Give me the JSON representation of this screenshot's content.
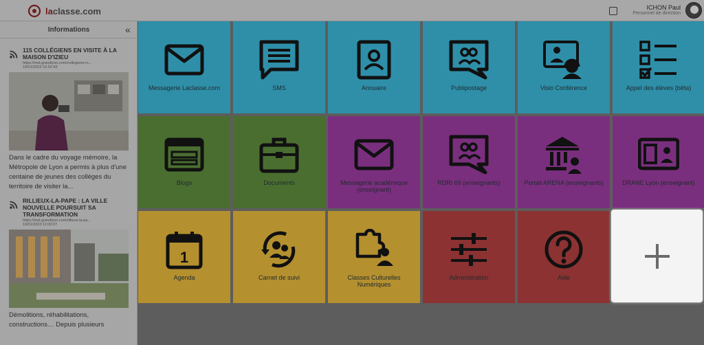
{
  "header": {
    "logo_brand": "la",
    "logo_rest": "classe.com",
    "user_name": "ICHON Paul",
    "user_role": "Personnel de direction"
  },
  "sidebar": {
    "title": "Informations",
    "news": [
      {
        "title": "115 COLLÉGIENS EN VISITE À LA MAISON D'IZIEU",
        "url": "https://met.grandlyon.com/collegiens-m...",
        "date": "19/01/2023 10:52:43",
        "excerpt": "Dans le cadre du voyage mémoire, la Métropole de Lyon a permis à plus d'une centaine de jeunes des collèges du territoire de visiter la..."
      },
      {
        "title": "RILLIEUX-LA-PAPE : LA VILLE NOUVELLE POURSUIT SA TRANSFORMATION",
        "url": "https://met.grandlyon.com/rillieux-la-pa...",
        "date": "19/01/2023 11:00:07",
        "excerpt": "Démolitions, réhabilitations, constructions… Depuis plusieurs"
      }
    ]
  },
  "tiles": [
    {
      "label": "Messagerie Laclasse.com",
      "icon": "envelope-icon",
      "color": "blue"
    },
    {
      "label": "SMS",
      "icon": "chat-icon",
      "color": "blue"
    },
    {
      "label": "Annuaire",
      "icon": "contact-card-icon",
      "color": "blue"
    },
    {
      "label": "Publipostage",
      "icon": "group-message-icon",
      "color": "blue"
    },
    {
      "label": "Visio Conférence",
      "icon": "video-conference-icon",
      "color": "blue"
    },
    {
      "label": "Appel des élèves (bêta)",
      "icon": "checklist-icon",
      "color": "blue"
    },
    {
      "label": "Blogs",
      "icon": "layout-icon",
      "color": "green"
    },
    {
      "label": "Documents",
      "icon": "briefcase-icon",
      "color": "green"
    },
    {
      "label": "Messagerie académique (enseignant)",
      "icon": "envelope-icon",
      "color": "purple"
    },
    {
      "label": "RDRI 69 (enseignants)",
      "icon": "group-message-icon",
      "color": "purple"
    },
    {
      "label": "Portail ARENA (enseignants)",
      "icon": "institution-icon",
      "color": "purple"
    },
    {
      "label": "DRANE Lyon (enseignant)",
      "icon": "id-panel-icon",
      "color": "purple"
    },
    {
      "label": "Agenda",
      "icon": "calendar-icon",
      "color": "yellow"
    },
    {
      "label": "Carnet de suivi",
      "icon": "user-cycle-icon",
      "color": "yellow"
    },
    {
      "label": "Classes Culturelles Numériques",
      "icon": "puzzle-user-icon",
      "color": "yellow"
    },
    {
      "label": "Administration",
      "icon": "sliders-icon",
      "color": "red"
    },
    {
      "label": "Aide",
      "icon": "question-icon",
      "color": "red"
    }
  ],
  "add_tile": {
    "icon": "plus-icon"
  }
}
